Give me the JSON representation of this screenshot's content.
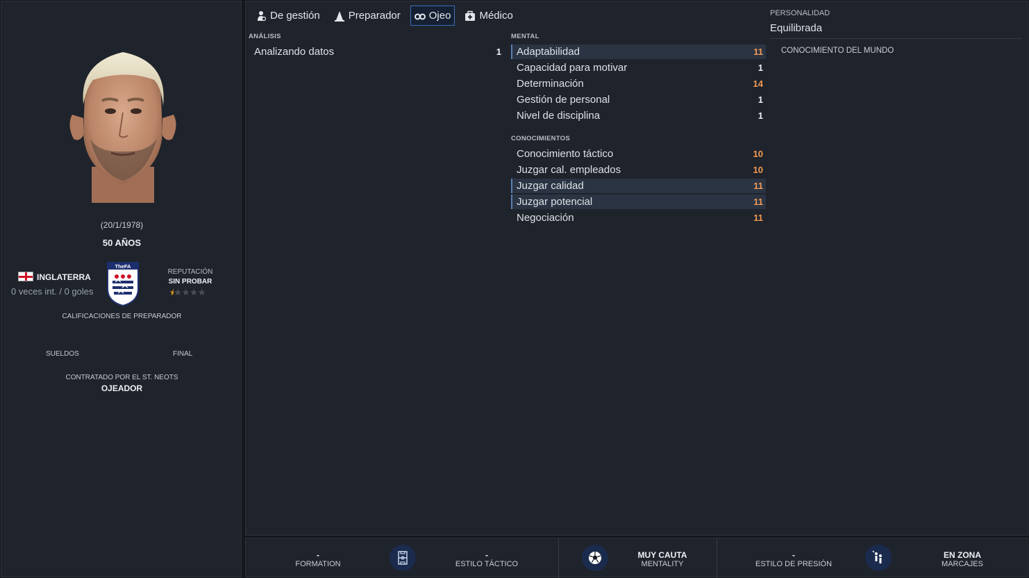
{
  "profile": {
    "dob": "(20/1/1978)",
    "age": "50 AÑOS",
    "nation": "INGLATERRA",
    "caps": "0 veces int. / 0 goles",
    "crest_label": "TheFA",
    "reputation_label": "REPUTACIÓN",
    "reputation_value": "SIN PROBAR",
    "reputation_stars": 0.5,
    "coach_ratings_label": "CALIFICACIONES DE PREPARADOR",
    "wages_label": "SUELDOS",
    "final_label": "FINAL",
    "hired_by": "CONTRATADO POR EL ST. NEOTS",
    "role": "OJEADOR"
  },
  "tabs": [
    {
      "label": "De gestión",
      "icon": "manager-icon"
    },
    {
      "label": "Preparador",
      "icon": "cone-icon"
    },
    {
      "label": "Ojeo",
      "icon": "binoculars-icon",
      "active": true
    },
    {
      "label": "Médico",
      "icon": "medical-kit-icon"
    }
  ],
  "analysis": {
    "heading": "ANÁLISIS",
    "rows": [
      {
        "label": "Analizando datos",
        "value": "1"
      }
    ]
  },
  "mental": {
    "heading": "MENTAL",
    "rows": [
      {
        "label": "Adaptabilidad",
        "value": "11"
      },
      {
        "label": "Capacidad para motivar",
        "value": "1"
      },
      {
        "label": "Determinación",
        "value": "14"
      },
      {
        "label": "Gestión de personal",
        "value": "1"
      },
      {
        "label": "Nivel de disciplina",
        "value": "1"
      }
    ]
  },
  "knowledge": {
    "heading": "CONOCIMIENTOS",
    "rows": [
      {
        "label": "Conocimiento táctico",
        "value": "10"
      },
      {
        "label": "Juzgar cal. empleados",
        "value": "10"
      },
      {
        "label": "Juzgar calidad",
        "value": "11"
      },
      {
        "label": "Juzgar potencial",
        "value": "11"
      },
      {
        "label": "Negociación",
        "value": "11"
      }
    ]
  },
  "personality": {
    "label": "PERSONALIDAD",
    "value": "Equilibrada",
    "world_knowledge": "CONOCIMIENTO DEL MUNDO"
  },
  "bottom": {
    "formation": {
      "value": "-",
      "label": "FORMATION"
    },
    "tactical_style": {
      "value": "-",
      "label": "ESTILO TÁCTICO"
    },
    "mentality": {
      "value": "MUY CAUTA",
      "label": "MENTALITY"
    },
    "pressing_style": {
      "value": "-",
      "label": "ESTILO DE PRESIÓN"
    },
    "marking": {
      "value": "EN ZONA",
      "label": "MARCAJES"
    }
  },
  "colors": {
    "panel": "#1f232b",
    "highlight": "#2b3443",
    "orange_value": "#f29a55",
    "tab_active": "#3d6fb8"
  }
}
